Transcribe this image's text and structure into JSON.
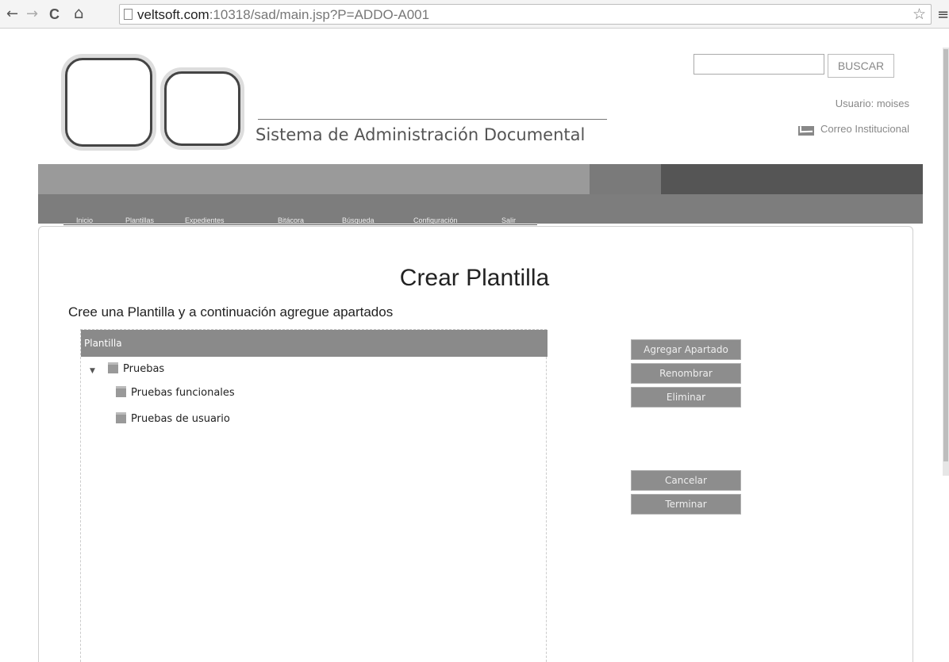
{
  "browser": {
    "back_glyph": "←",
    "forward_glyph": "→",
    "reload_glyph": "C",
    "home_glyph": "⌂",
    "url_host": "veltsoft.com",
    "url_rest": ":10318/sad/main.jsp?P=ADDO-A001",
    "star_glyph": "☆",
    "menu_glyph": "≡"
  },
  "header": {
    "system_title": "Sistema de Administración Documental",
    "search_button": "BUSCAR",
    "search_value": "",
    "user_label": "Usuario: moises",
    "mail_label": "Correo Institucional"
  },
  "menu": {
    "items": [
      "Inicio",
      "Plantillas",
      "Expedientes",
      "Bitácora",
      "Búsqueda",
      "Configuración",
      "Salir"
    ]
  },
  "main": {
    "title": "Crear Plantilla",
    "subtitle": "Cree una Plantilla y a continuación agregue apartados",
    "tree_header": "Plantilla",
    "tree": {
      "root": "Pruebas",
      "children": [
        "Pruebas funcionales",
        "Pruebas de usuario"
      ]
    },
    "buttons": {
      "add_section": "Agregar Apartado",
      "rename": "Renombrar",
      "delete": "Eliminar",
      "cancel": "Cancelar",
      "finish": "Terminar"
    }
  },
  "colors": {
    "banner": "#9a9a9a",
    "banner_dark": "#555555",
    "menubar": "#7d7d7d",
    "button": "#8d8d8d"
  }
}
